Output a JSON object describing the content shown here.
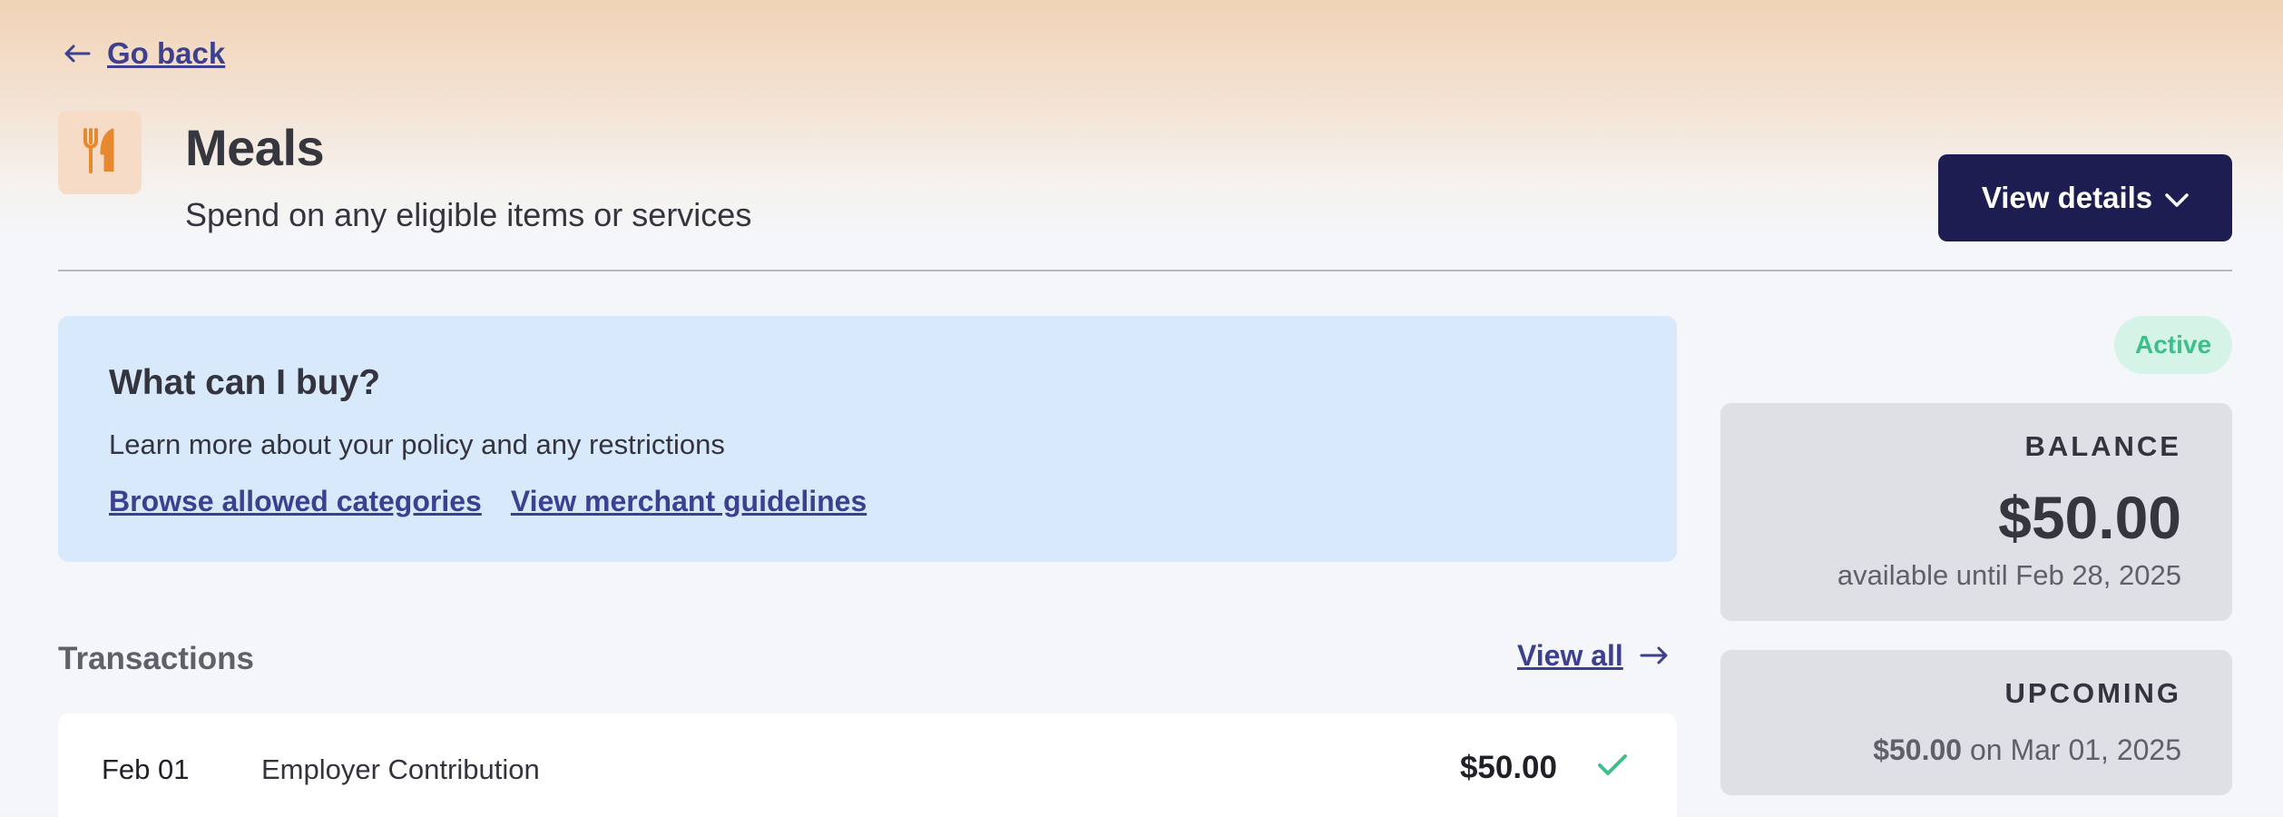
{
  "nav": {
    "back_label": "Go back"
  },
  "header": {
    "title": "Meals",
    "subtitle": "Spend on any eligible items or services",
    "view_details_label": "View details",
    "category_icon": "fork-knife-icon",
    "accent_color": "#e7892f"
  },
  "info_card": {
    "title": "What can I buy?",
    "description": "Learn more about your policy and any restrictions",
    "links": [
      "Browse allowed categories",
      "View merchant guidelines"
    ]
  },
  "transactions": {
    "heading": "Transactions",
    "view_all_label": "View all",
    "rows": [
      {
        "date": "Feb 01",
        "description": "Employer Contribution",
        "amount": "$50.00",
        "status_icon": "check-icon"
      }
    ]
  },
  "status": {
    "label": "Active",
    "color": "#3dbf8b"
  },
  "balance": {
    "label": "BALANCE",
    "amount": "$50.00",
    "availability": "available until Feb 28, 2025"
  },
  "upcoming": {
    "label": "UPCOMING",
    "amount": "$50.00",
    "date_text": "on Mar 01, 2025"
  },
  "colors": {
    "primary_button": "#1e1d52",
    "link": "#3d3f8f",
    "info_bg": "#d8e9fb"
  }
}
